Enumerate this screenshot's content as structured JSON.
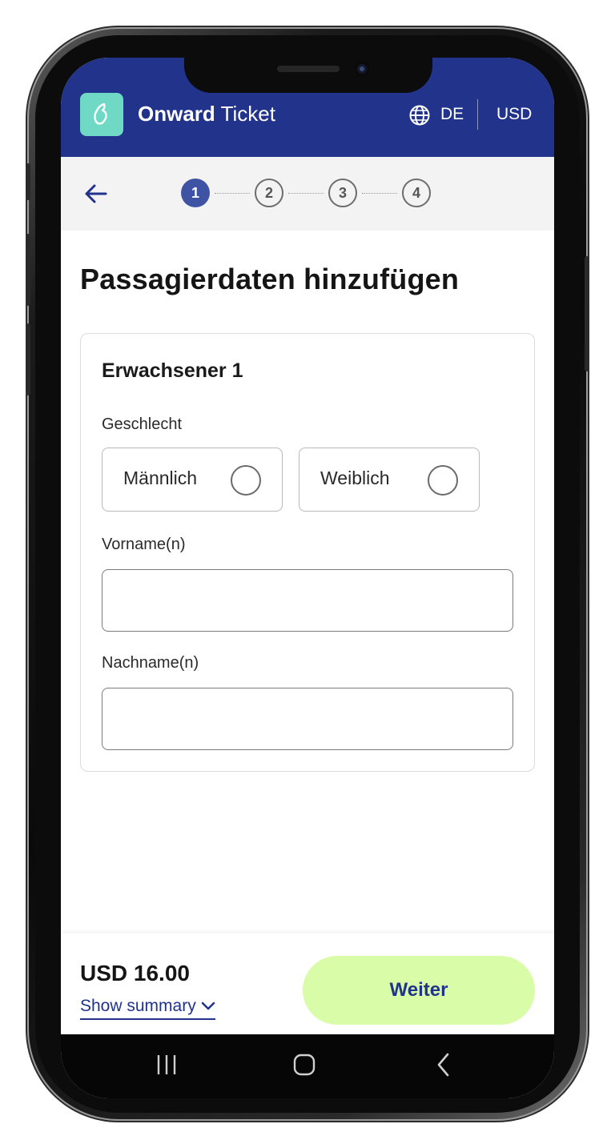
{
  "header": {
    "brand_bold": "Onward",
    "brand_regular": "Ticket",
    "language": "DE",
    "currency": "USD",
    "logo_icon": "onward-logo-icon",
    "globe_icon": "globe-icon",
    "background_color": "#21338b",
    "logo_color": "#6fd9c5"
  },
  "stepper": {
    "back_icon": "arrow-left-icon",
    "steps": [
      "1",
      "2",
      "3",
      "4"
    ],
    "active_step": "1"
  },
  "page": {
    "title": "Passagierdaten hinzufügen"
  },
  "passenger_form": {
    "title": "Erwachsener 1",
    "gender_label": "Geschlecht",
    "gender_options": [
      "Männlich",
      "Weiblich"
    ],
    "first_name_label": "Vorname(n)",
    "first_name_value": "",
    "last_name_label": "Nachname(n)",
    "last_name_value": ""
  },
  "footer": {
    "price": "USD 16.00",
    "summary_link": "Show summary",
    "summary_icon": "chevron-down-icon",
    "next_button": "Weiter",
    "next_button_color": "#d9fca9"
  },
  "system_nav": {
    "icons": [
      "recent-apps-icon",
      "home-icon",
      "back-icon"
    ]
  }
}
